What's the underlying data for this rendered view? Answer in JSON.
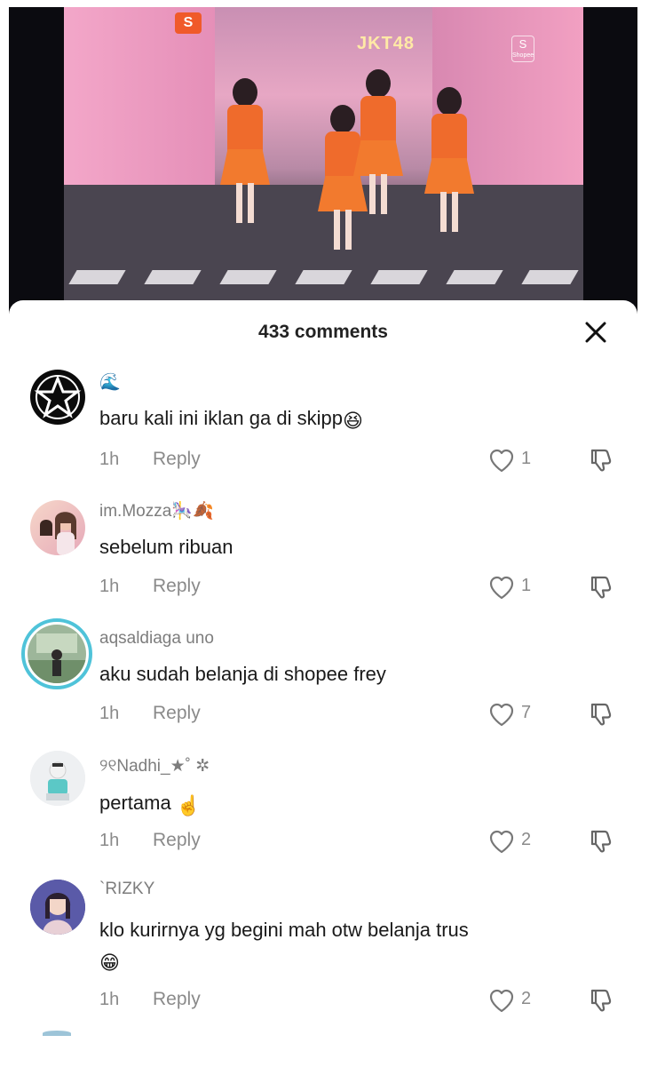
{
  "video": {
    "brand_tag": "JKT48",
    "shop_badge": "S",
    "shop_badge_2": "S",
    "shop_badge_2_caption": "Shopee"
  },
  "sheet": {
    "title": "433 comments"
  },
  "comments": [
    {
      "username": "🌊",
      "text": "baru kali ini iklan ga di skipp",
      "emoji": "😆",
      "time": "1h",
      "reply_label": "Reply",
      "likes": "1"
    },
    {
      "username": "im.Mozza🎠🍂",
      "text": "sebelum ribuan",
      "time": "1h",
      "reply_label": "Reply",
      "likes": "1"
    },
    {
      "username": "aqsaldiaga uno",
      "text": "aku sudah belanja di shopee frey",
      "time": "1h",
      "reply_label": "Reply",
      "likes": "7"
    },
    {
      "username": "୨୧Nadhi_★˚ ✲",
      "text": "pertama",
      "emoji": "☝️",
      "time": "1h",
      "reply_label": "Reply",
      "likes": "2"
    },
    {
      "username": "`RIZKY",
      "text": "klo kurirnya yg begini mah otw belanja trus",
      "emoji": "😁",
      "time": "1h",
      "reply_label": "Reply",
      "likes": "2"
    }
  ],
  "icons": {
    "close": "close-icon",
    "like": "heart-icon",
    "dislike": "thumbs-down-icon"
  },
  "colors": {
    "text_primary": "#1a1a1a",
    "text_secondary": "#8a8a8a",
    "avatar_ring_active": "#4fc3d9"
  }
}
